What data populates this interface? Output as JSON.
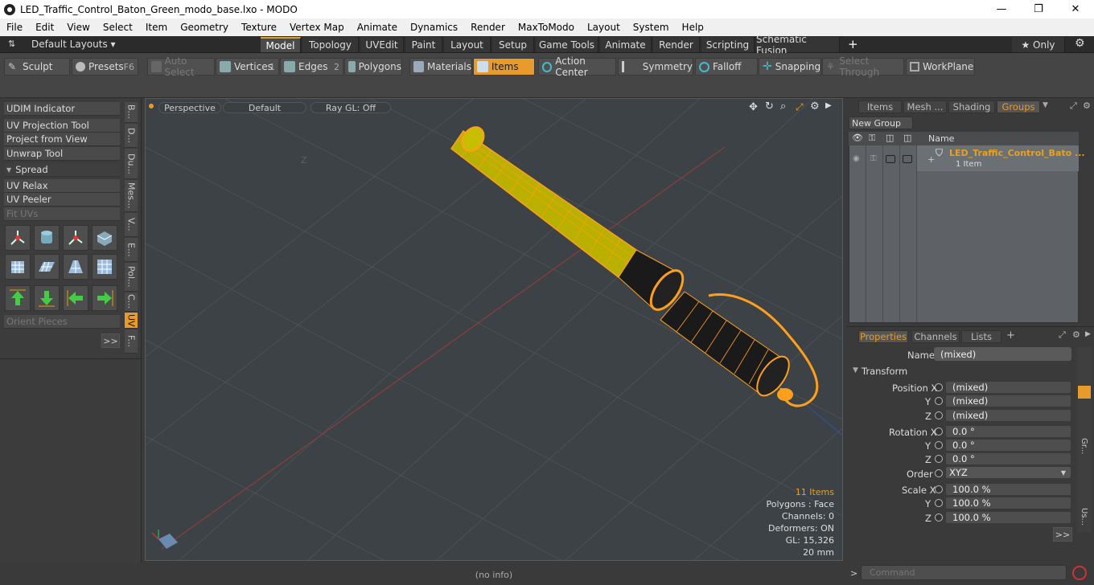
{
  "window": {
    "title": "LED_Traffic_Control_Baton_Green_modo_base.lxo - MODO",
    "minimize": "—",
    "maximize": "❐",
    "close": "✕"
  },
  "menu": [
    "File",
    "Edit",
    "View",
    "Select",
    "Item",
    "Geometry",
    "Texture",
    "Vertex Map",
    "Animate",
    "Dynamics",
    "Render",
    "MaxToModo",
    "Layout",
    "System",
    "Help"
  ],
  "layout": {
    "preset": "Default Layouts ▾",
    "tabs": [
      "Model",
      "Topology",
      "UVEdit",
      "Paint",
      "Layout",
      "Setup",
      "Game Tools",
      "Animate",
      "Render",
      "Scripting",
      "Schematic Fusion"
    ],
    "plus": "+",
    "only": "★  Only"
  },
  "toolbar": {
    "sculpt": "Sculpt",
    "presets": "Presets",
    "presets_key": "F6",
    "auto_select": "Auto Select",
    "vertices": "Vertices",
    "vertices_num": "1",
    "edges": "Edges",
    "edges_num": "2",
    "polygons": "Polygons",
    "materials": "Materials",
    "items": "Items",
    "action_center": "Action Center",
    "symmetry": "Symmetry",
    "falloff": "Falloff",
    "snapping": "Snapping",
    "select_through": "Select Through",
    "workplane": "WorkPlane"
  },
  "left": {
    "udim": "UDIM Indicator",
    "uv_projection": "UV Projection Tool",
    "project_view": "Project from View",
    "unwrap": "Unwrap Tool",
    "spread": "Spread",
    "uv_relax": "UV Relax",
    "uv_peeler": "UV Peeler",
    "fit_uvs": "Fit UVs",
    "orient": "Orient Pieces",
    "more": ">>",
    "vtabs": [
      "B...",
      "D...",
      "Du...",
      "Mes...",
      "V...",
      "E...",
      "Pol...",
      "C...",
      "UV",
      "F..."
    ]
  },
  "viewport": {
    "perspective": "Perspective",
    "default": "Default",
    "raygl": "Ray GL: Off",
    "axis_label": "Z",
    "stats": {
      "items": "11 Items",
      "polygons": "Polygons : Face",
      "channels": "Channels: 0",
      "deformers": "Deformers: ON",
      "gl": "GL: 15,326",
      "scale": "20 mm"
    }
  },
  "status": {
    "info": "(no info)"
  },
  "right": {
    "tabs": [
      "Items",
      "Mesh ...",
      "Shading",
      "Groups"
    ],
    "new_group": "New Group",
    "col_name": "Name",
    "group_name": "LED_Traffic_Control_Bato ...",
    "group_count": "1 Item",
    "prop_tabs": [
      "Properties",
      "Channels",
      "Lists"
    ],
    "name_label": "Name",
    "name_value": "(mixed)",
    "transform": "Transform",
    "pos_x_label": "Position X",
    "pos_y_label": "Y",
    "pos_z_label": "Z",
    "pos_x": "(mixed)",
    "pos_y": "(mixed)",
    "pos_z": "(mixed)",
    "rot_x_label": "Rotation X",
    "rot_y_label": "Y",
    "rot_z_label": "Z",
    "rot_x": "0.0 °",
    "rot_y": "0.0 °",
    "rot_z": "0.0 °",
    "order_label": "Order",
    "order": "XYZ",
    "scale_x_label": "Scale X",
    "scale_y_label": "Y",
    "scale_z_label": "Z",
    "scale_x": "100.0 %",
    "scale_y": "100.0 %",
    "scale_z": "100.0 %",
    "more": ">>",
    "command_prompt": ">",
    "command_placeholder": "Command",
    "side_tabs": [
      "Gr...",
      "Us..."
    ]
  },
  "colors": {
    "accent": "#e89a2a",
    "viewport_bg": "#3d4246",
    "baton_yellow": "#b9b000",
    "wire": "#ff9f1c"
  }
}
